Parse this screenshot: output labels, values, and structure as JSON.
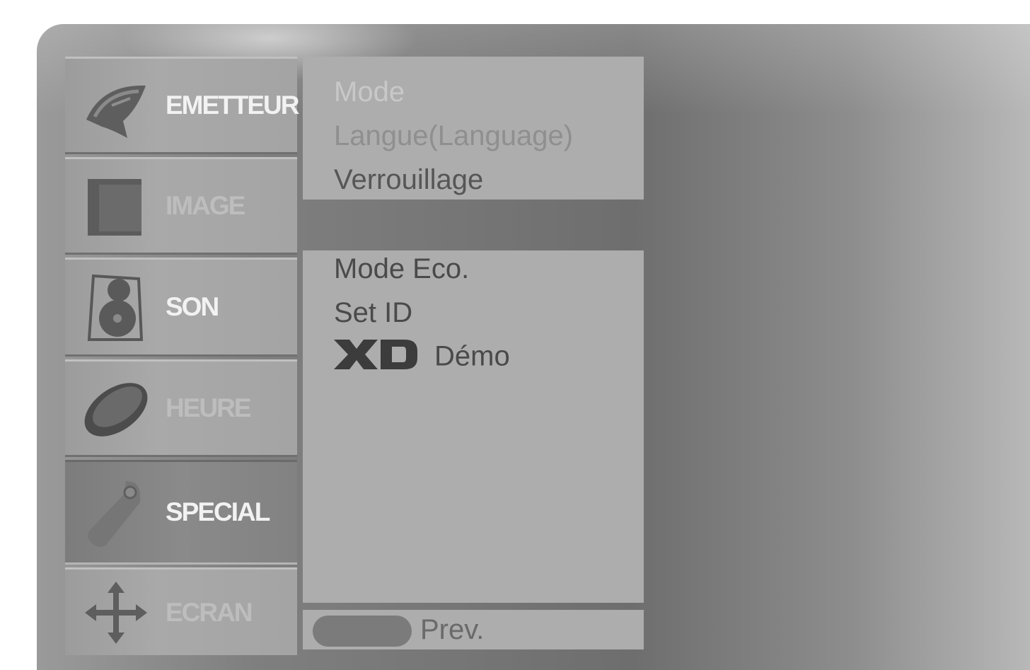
{
  "categories": [
    {
      "label": "EMETTEUR",
      "icon": "satellite-dish-icon",
      "state": "normal"
    },
    {
      "label": "IMAGE",
      "icon": "picture-frame-icon",
      "state": "dim"
    },
    {
      "label": "SON",
      "icon": "speaker-icon",
      "state": "normal"
    },
    {
      "label": "HEURE",
      "icon": "clock-disc-icon",
      "state": "dim"
    },
    {
      "label": "SPECIAL",
      "icon": "tag-icon",
      "state": "selected"
    },
    {
      "label": "ECRAN",
      "icon": "move-arrows-icon",
      "state": "dim"
    }
  ],
  "options_top": [
    "Mode",
    "Langue(Language)",
    "Verrouillage"
  ],
  "options_bottom": [
    "Mode Eco.",
    "Set ID",
    "Démo"
  ],
  "xd_logo": "XD",
  "footer": {
    "prev_label": "Prev."
  },
  "colors": {
    "panel": "#adadad",
    "selected_category": "#858585",
    "text_dark": "#4a4a4a"
  }
}
